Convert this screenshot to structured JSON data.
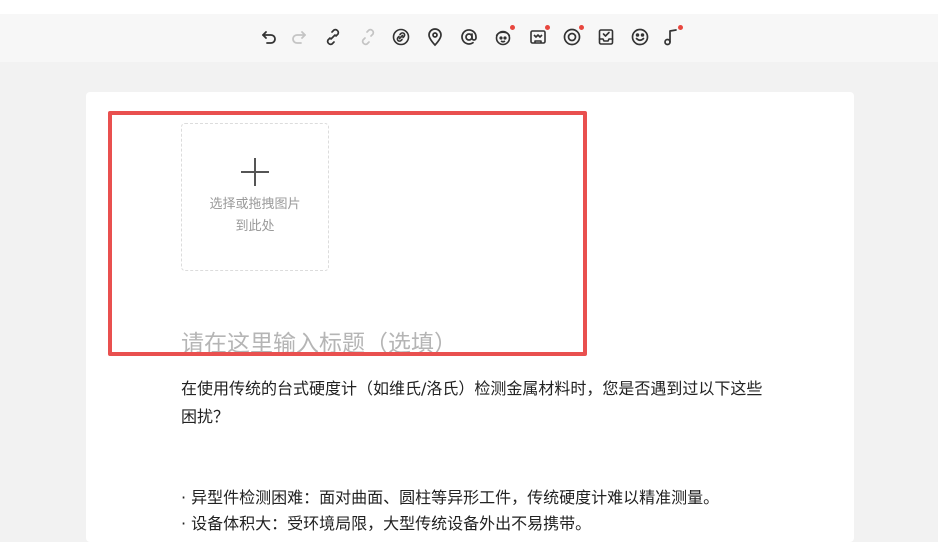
{
  "toolbar": {
    "tools": [
      {
        "name": "undo-icon",
        "enabled": true,
        "badge": false
      },
      {
        "name": "redo-icon",
        "enabled": false,
        "badge": false
      },
      {
        "name": "link-icon",
        "enabled": true,
        "badge": false
      },
      {
        "name": "unlink-icon",
        "enabled": false,
        "badge": false
      },
      {
        "name": "link-card-icon",
        "enabled": true,
        "badge": false
      },
      {
        "name": "location-icon",
        "enabled": true,
        "badge": false
      },
      {
        "name": "mention-icon",
        "enabled": true,
        "badge": false
      },
      {
        "name": "avatar-icon",
        "enabled": true,
        "badge": true
      },
      {
        "name": "image-card-icon",
        "enabled": true,
        "badge": true
      },
      {
        "name": "target-icon",
        "enabled": true,
        "badge": true
      },
      {
        "name": "inbox-icon",
        "enabled": true,
        "badge": false
      },
      {
        "name": "emoji-icon",
        "enabled": true,
        "badge": false
      },
      {
        "name": "music-icon",
        "enabled": true,
        "badge": true
      }
    ],
    "badge_color": "#e8463e"
  },
  "upload": {
    "hint_line1": "选择或拖拽图片",
    "hint_line2": "到此处"
  },
  "editor": {
    "title_placeholder": "请在这里输入标题（选填）",
    "paragraph1": "在使用传统的台式硬度计（如维氏/洛氏）检测金属材料时，您是否遇到过以下这些困扰？",
    "bullet1": "· 异型件检测困难：面对曲面、圆柱等异形工件，传统硬度计难以精准测量。",
    "bullet2": "· 设备体积大：受环境局限，大型传统设备外出不易携带。"
  },
  "highlight_color": "#e9504f"
}
